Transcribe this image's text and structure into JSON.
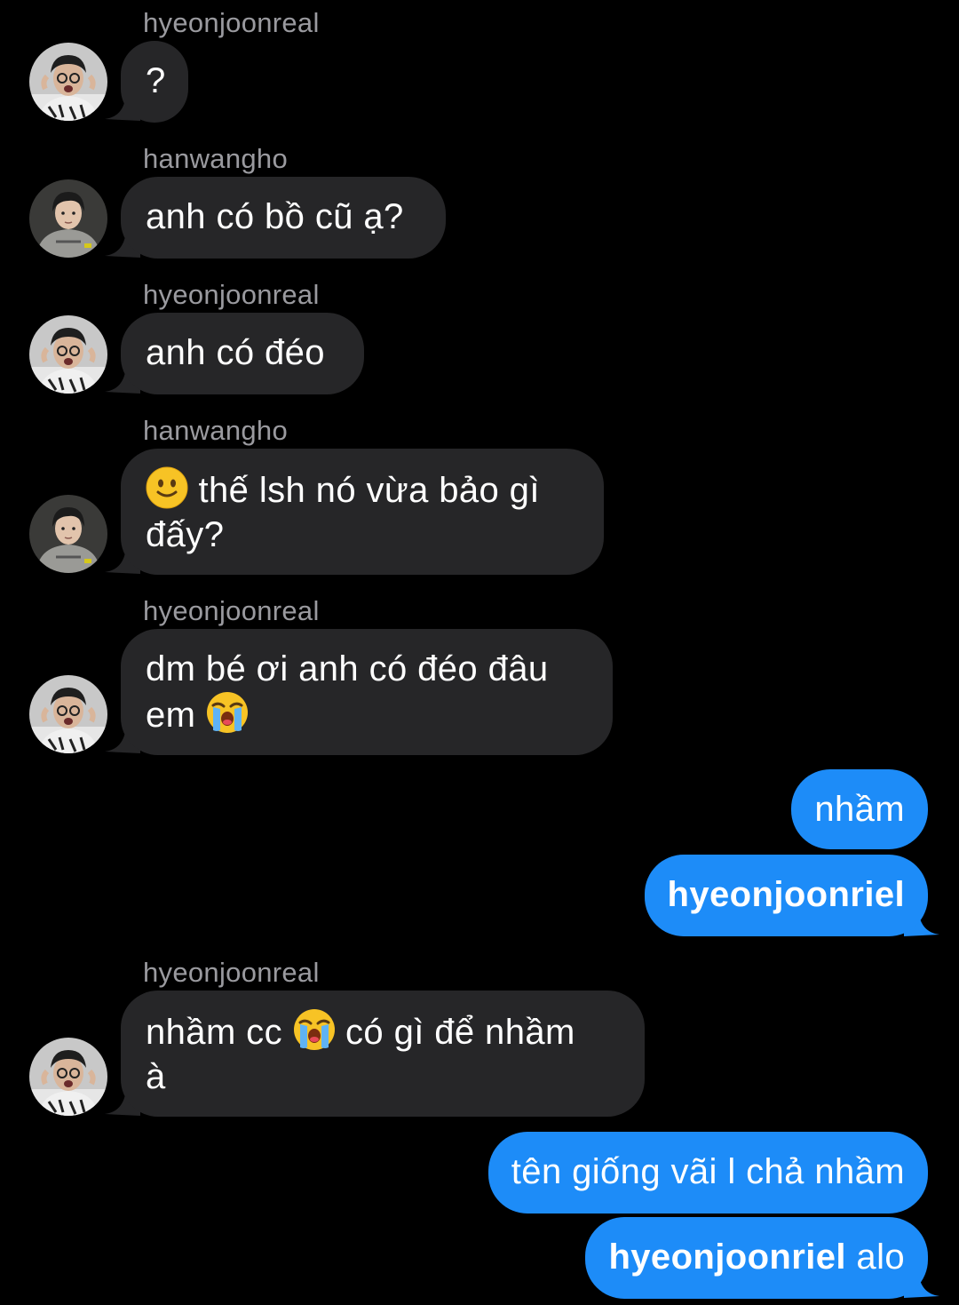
{
  "messages": [
    {
      "sender": "hyeonjoonreal",
      "text": "?"
    },
    {
      "sender": "hanwangho",
      "text": "anh có bồ cũ ạ?"
    },
    {
      "sender": "hyeonjoonreal",
      "text": "anh có đéo"
    },
    {
      "sender": "hanwangho",
      "emoji": "slightly-smiling-face",
      "line1": "thế lsh nó vừa bảo gì",
      "line2": "đấy?"
    },
    {
      "sender": "hyeonjoonreal",
      "line1": "dm bé ơi anh có đéo đâu",
      "line2": "em",
      "emoji": "loudly-crying-face"
    },
    {
      "sender": "me",
      "text": "nhầm"
    },
    {
      "sender": "me",
      "text": "hyeonjoonriel"
    },
    {
      "sender": "hyeonjoonreal",
      "line1a": "nhầm cc",
      "emoji": "loudly-crying-face",
      "line1b": "có gì để nhầm",
      "line2": "à"
    },
    {
      "sender": "me",
      "text": "tên giống vãi l chả nhầm"
    },
    {
      "sender": "me",
      "bold": "hyeonjoonriel",
      "text": " alo"
    }
  ],
  "colors": {
    "background": "#000000",
    "incoming_bubble": "#262628",
    "outgoing_bubble": "#1d8cf8",
    "sender_name": "#9a9a9f",
    "text": "#ffffff"
  }
}
